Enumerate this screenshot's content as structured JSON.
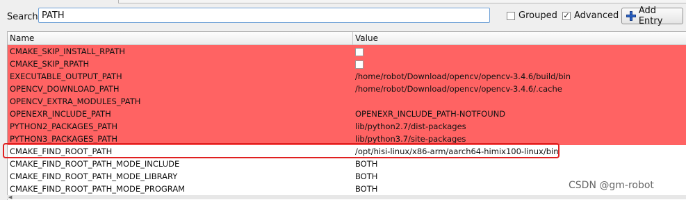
{
  "toolbar": {
    "search_label": "Search:",
    "search_value": "PATH",
    "grouped_label": "Grouped",
    "grouped_checked": false,
    "advanced_label": "Advanced",
    "advanced_checked": true,
    "add_entry_label": "Add Entry"
  },
  "table": {
    "headers": {
      "name": "Name",
      "value": "Value"
    },
    "rows": [
      {
        "name": "CMAKE_SKIP_INSTALL_RPATH",
        "value": "",
        "type": "bool",
        "state": "new"
      },
      {
        "name": "CMAKE_SKIP_RPATH",
        "value": "",
        "type": "bool",
        "state": "new"
      },
      {
        "name": "EXECUTABLE_OUTPUT_PATH",
        "value": "/home/robot/Download/opencv/opencv-3.4.6/build/bin",
        "type": "text",
        "state": "new"
      },
      {
        "name": "OPENCV_DOWNLOAD_PATH",
        "value": "/home/robot/Download/opencv/opencv-3.4.6/.cache",
        "type": "text",
        "state": "new"
      },
      {
        "name": "OPENCV_EXTRA_MODULES_PATH",
        "value": "",
        "type": "text",
        "state": "new"
      },
      {
        "name": "OPENEXR_INCLUDE_PATH",
        "value": "OPENEXR_INCLUDE_PATH-NOTFOUND",
        "type": "text",
        "state": "new"
      },
      {
        "name": "PYTHON2_PACKAGES_PATH",
        "value": "lib/python2.7/dist-packages",
        "type": "text",
        "state": "new"
      },
      {
        "name": "PYTHON3_PACKAGES_PATH",
        "value": "lib/python3.7/site-packages",
        "type": "text",
        "state": "new"
      },
      {
        "name": "CMAKE_FIND_ROOT_PATH",
        "value": "/opt/hisi-linux/x86-arm/aarch64-himix100-linux/bin",
        "type": "text",
        "state": "normal"
      },
      {
        "name": "CMAKE_FIND_ROOT_PATH_MODE_INCLUDE",
        "value": "BOTH",
        "type": "text",
        "state": "normal"
      },
      {
        "name": "CMAKE_FIND_ROOT_PATH_MODE_LIBRARY",
        "value": "BOTH",
        "type": "text",
        "state": "normal"
      },
      {
        "name": "CMAKE_FIND_ROOT_PATH_MODE_PROGRAM",
        "value": "BOTH",
        "type": "text",
        "state": "normal"
      }
    ]
  },
  "colors": {
    "new_entry_bg": "#ff6363",
    "normal_bg": "#ffffff",
    "highlight_border": "#e02020"
  },
  "watermark": "CSDN @gm-robot"
}
